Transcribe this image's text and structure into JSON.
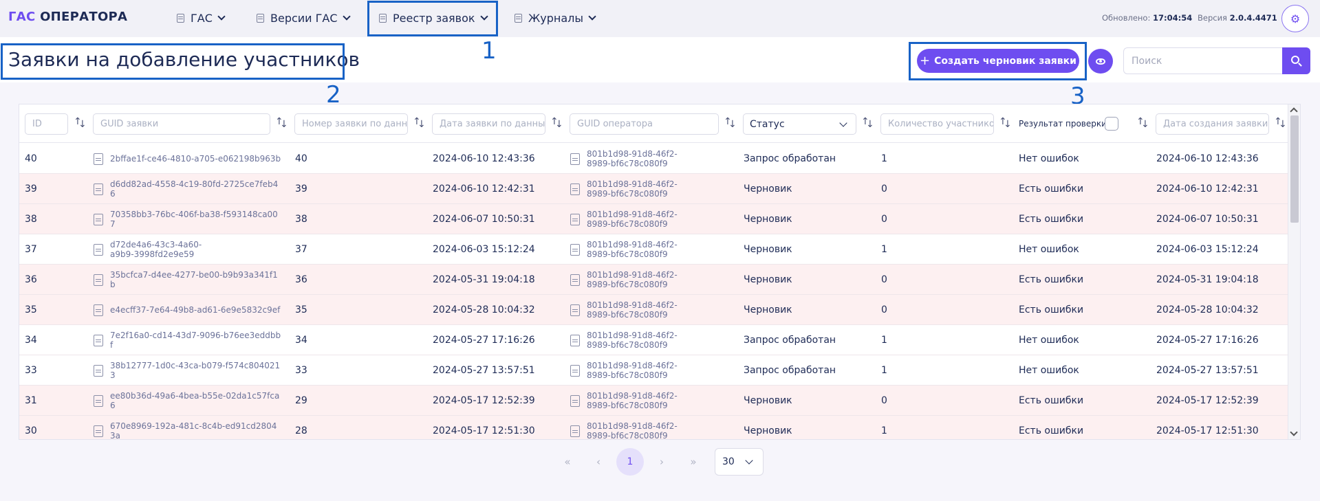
{
  "brand": {
    "part1": "ГАС",
    "part2": " ОПЕРАТОРА"
  },
  "nav": [
    {
      "label": "ГАС"
    },
    {
      "label": "Версии ГАС"
    },
    {
      "label": "Реестр заявок"
    },
    {
      "label": "Журналы"
    }
  ],
  "status": {
    "updated_label": "Обновлено:",
    "updated_value": "17:04:54",
    "version_label": "Версия",
    "version_value": "2.0.4.4471"
  },
  "annotations": {
    "n1": "1",
    "n2": "2",
    "n3": "3"
  },
  "page": {
    "title": "Заявки на добавление участников",
    "create_label": "Создать черновик заявки",
    "search_placeholder": "Поиск"
  },
  "filters": {
    "id": "ID",
    "guid": "GUID заявки",
    "number": "Номер заявки по данны",
    "date": "Дата заявки по данны",
    "operator": "GUID оператора",
    "status": "Статус",
    "count": "Количество участнико",
    "result": "Результат проверки",
    "created": "Дата создания заявки"
  },
  "rows": [
    {
      "id": "40",
      "guid": "2bffae1f-ce46-4810-a705-e062198b963b",
      "num": "40",
      "date": "2024-06-10 12:43:36",
      "op": "801b1d98-91d8-46f2-8989-bf6c78c080f9",
      "status": "Запрос обработан",
      "count": "1",
      "result": "Нет ошибок",
      "created": "2024-06-10 12:43:36",
      "state": "ok"
    },
    {
      "id": "39",
      "guid": "d6dd82ad-4558-4c19-80fd-2725ce7feb46",
      "num": "39",
      "date": "2024-06-10 12:42:31",
      "op": "801b1d98-91d8-46f2-8989-bf6c78c080f9",
      "status": "Черновик",
      "count": "0",
      "result": "Есть ошибки",
      "created": "2024-06-10 12:42:31",
      "state": "err"
    },
    {
      "id": "38",
      "guid": "70358bb3-76bc-406f-ba38-f593148ca007",
      "num": "38",
      "date": "2024-06-07 10:50:31",
      "op": "801b1d98-91d8-46f2-8989-bf6c78c080f9",
      "status": "Черновик",
      "count": "0",
      "result": "Есть ошибки",
      "created": "2024-06-07 10:50:31",
      "state": "err"
    },
    {
      "id": "37",
      "guid": "d72de4a6-43c3-4a60-a9b9-3998fd2e9e59",
      "num": "37",
      "date": "2024-06-03 15:12:24",
      "op": "801b1d98-91d8-46f2-8989-bf6c78c080f9",
      "status": "Черновик",
      "count": "1",
      "result": "Нет ошибок",
      "created": "2024-06-03 15:12:24",
      "state": "ok"
    },
    {
      "id": "36",
      "guid": "35bcfca7-d4ee-4277-be00-b9b93a341f1b",
      "num": "36",
      "date": "2024-05-31 19:04:18",
      "op": "801b1d98-91d8-46f2-8989-bf6c78c080f9",
      "status": "Черновик",
      "count": "0",
      "result": "Есть ошибки",
      "created": "2024-05-31 19:04:18",
      "state": "err"
    },
    {
      "id": "35",
      "guid": "e4ecff37-7e64-49b8-ad61-6e9e5832c9ef",
      "num": "35",
      "date": "2024-05-28 10:04:32",
      "op": "801b1d98-91d8-46f2-8989-bf6c78c080f9",
      "status": "Черновик",
      "count": "0",
      "result": "Есть ошибки",
      "created": "2024-05-28 10:04:32",
      "state": "err"
    },
    {
      "id": "34",
      "guid": "7e2f16a0-cd14-43d7-9096-b76ee3eddbbf",
      "num": "34",
      "date": "2024-05-27 17:16:26",
      "op": "801b1d98-91d8-46f2-8989-bf6c78c080f9",
      "status": "Запрос обработан",
      "count": "1",
      "result": "Нет ошибок",
      "created": "2024-05-27 17:16:26",
      "state": "ok"
    },
    {
      "id": "33",
      "guid": "38b12777-1d0c-43ca-b079-f574c8040213",
      "num": "33",
      "date": "2024-05-27 13:57:51",
      "op": "801b1d98-91d8-46f2-8989-bf6c78c080f9",
      "status": "Запрос обработан",
      "count": "1",
      "result": "Нет ошибок",
      "created": "2024-05-27 13:57:51",
      "state": "ok"
    },
    {
      "id": "31",
      "guid": "ee80b36d-49a6-4bea-b55e-02da1c57fca6",
      "num": "29",
      "date": "2024-05-17 12:52:39",
      "op": "801b1d98-91d8-46f2-8989-bf6c78c080f9",
      "status": "Черновик",
      "count": "0",
      "result": "Есть ошибки",
      "created": "2024-05-17 12:52:39",
      "state": "err"
    },
    {
      "id": "30",
      "guid": "670e8969-192a-481c-8c4b-ed91cd28043a",
      "num": "28",
      "date": "2024-05-17 12:51:30",
      "op": "801b1d98-91d8-46f2-8989-bf6c78c080f9",
      "status": "Черновик",
      "count": "1",
      "result": "Есть ошибки",
      "created": "2024-05-17 12:51:30",
      "state": "err"
    }
  ],
  "pagination": {
    "first": "«",
    "prev": "‹",
    "current": "1",
    "next": "›",
    "last": "»",
    "page_size": "30"
  },
  "colors": {
    "accent": "#6e4df0",
    "highlight": "#1862c6",
    "error_row": "#fdf0f1"
  }
}
